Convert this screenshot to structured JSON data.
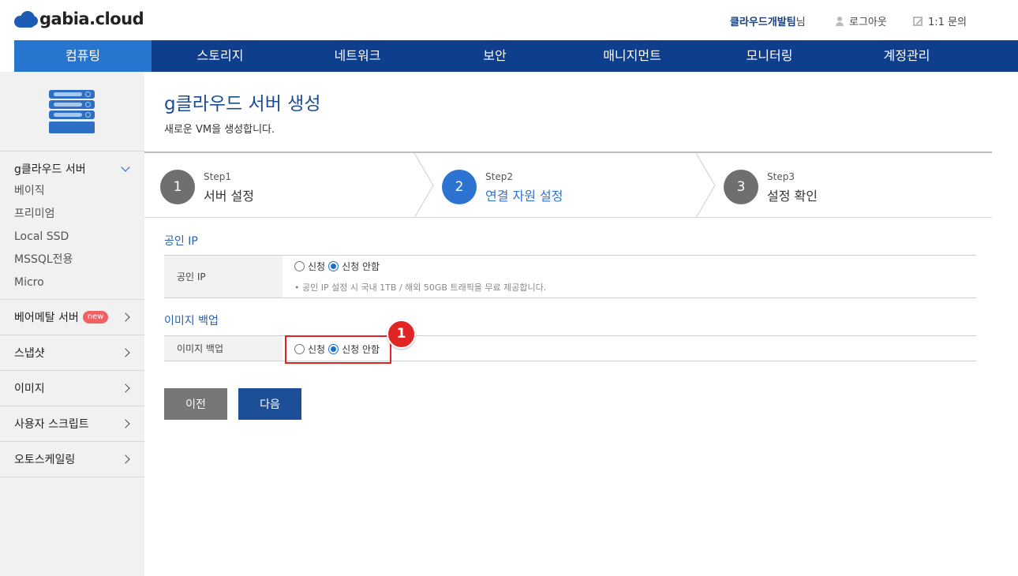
{
  "header": {
    "logo_text": "gabia.cloud",
    "user_name": "클라우드개발팀",
    "user_suffix": "님",
    "logout": "로그아웃",
    "inquiry": "1:1 문의"
  },
  "nav": {
    "items": [
      "컴퓨팅",
      "스토리지",
      "네트워크",
      "보안",
      "매니지먼트",
      "모니터링",
      "계정관리"
    ],
    "active_index": 0
  },
  "sidebar": {
    "groups": [
      {
        "label": "g클라우드 서버",
        "expanded": true,
        "items": [
          "베이직",
          "프리미엄",
          "Local SSD",
          "MSSQL전용",
          "Micro"
        ]
      },
      {
        "label": "베어메탈 서버",
        "badge": "new"
      },
      {
        "label": "스냅샷"
      },
      {
        "label": "이미지"
      },
      {
        "label": "사용자 스크립트"
      },
      {
        "label": "오토스케일링"
      }
    ]
  },
  "page": {
    "title": "g클라우드 서버 생성",
    "description": "새로운 VM을 생성합니다."
  },
  "steps": [
    {
      "number": "1",
      "small": "Step1",
      "label": "서버 설정",
      "active": false
    },
    {
      "number": "2",
      "small": "Step2",
      "label": "연결 자원 설정",
      "active": true
    },
    {
      "number": "3",
      "small": "Step3",
      "label": "설정 확인",
      "active": false
    }
  ],
  "public_ip": {
    "section_title": "공인 IP",
    "label": "공인 IP",
    "option_apply": "신청",
    "option_none": "신청 안함",
    "selected": "신청 안함",
    "note": "• 공인 IP 설정 시 국내 1TB / 해외 50GB 트래픽을 무료 제공합니다."
  },
  "image_backup": {
    "section_title": "이미지 백업",
    "label": "이미지 백업",
    "option_apply": "신청",
    "option_none": "신청 안함",
    "selected": "신청 안함"
  },
  "annotation": {
    "marker": "1",
    "color": "#e02424"
  },
  "buttons": {
    "prev": "이전",
    "next": "다음"
  },
  "colors": {
    "nav_bg": "#0e3e8c",
    "nav_active": "#2675cf",
    "accent": "#2d74d2"
  }
}
